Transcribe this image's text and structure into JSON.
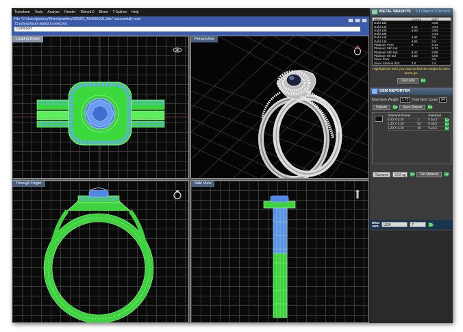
{
  "menubar": {
    "items": [
      "Transform",
      "Tools",
      "Analyze",
      "Render",
      "Rhino4.0",
      "Blend",
      "T-Splines",
      "Help"
    ]
  },
  "command": {
    "lines": [
      "File \"C:\\Users\\jpm\\ocs\\Rhino\\jewellery\\922822_RGW51201.3dm\" successfully read",
      "73 polysurfaces added to selection."
    ],
    "prompt": "Command:"
  },
  "viewports": {
    "top_left": {
      "title": "Looking Down"
    },
    "top_right": {
      "title": "Perspective"
    },
    "bottom_left": {
      "title": "Through Finger"
    },
    "bottom_right": {
      "title": "Side View"
    }
  },
  "metal_weights": {
    "header": "METAL WEIGHTS",
    "note": "13 Objects Checked",
    "columns": [
      "Metal",
      "Grams",
      "DWT"
    ],
    "rows": [
      [
        "Gold 18k",
        "",
        "4.63"
      ],
      [
        "Gold 14k",
        "5.44",
        "4.04"
      ],
      [
        "Gold 10k",
        "5.50",
        "3.50"
      ],
      [
        "Gold 18k",
        "",
        "4.34"
      ],
      [
        "Gold 14k",
        "4.95",
        "2.5"
      ],
      [
        "Gold 14k",
        "4.95",
        "2.9"
      ],
      [
        "Platinum Pure",
        "9",
        "5.14"
      ],
      [
        "Platinum 950 Ind",
        "",
        "5.74"
      ],
      [
        "Platinum 950 Ind",
        "9.02",
        "5.80"
      ],
      [
        "Platinum 85 Ind",
        "8.60",
        "5.80"
      ],
      [
        "Silver Pure",
        "",
        "2.6"
      ],
      [
        "Silver Sterling 925",
        "3.8",
        "2.4"
      ]
    ],
    "hint": "Highlight the item you want to find the weight for then press go.",
    "calculate_label": "Calculate"
  },
  "gem_reporter": {
    "header": "GEM REPORTER",
    "total_weight_label": "Total Gem Weight",
    "total_weight_value": "1.73",
    "total_count_label": "Total Gem Count",
    "total_count_value": "94",
    "update_label": "Update",
    "save_label": "Save Report",
    "columns": [
      "Diamond Round",
      "",
      "Diamond"
    ],
    "rows": [
      {
        "size": "5.20 X 5.20",
        "qty": "1",
        "ct": "0.51ct"
      },
      {
        "size": "1.30 X 1.30",
        "qty": "52",
        "ct": "0.48ct"
      },
      {
        "size": "1.20 X 1.20",
        "qty": "40",
        "ct": "0.23ct"
      }
    ],
    "gem_select": "Diamond",
    "gem_value": "3.52 sg",
    "set_material_label": "Set Material"
  },
  "ring_size": {
    "label_line1": "RING",
    "label_line2": "SIZE",
    "standard": "USA",
    "size": "7"
  },
  "go_label": "Go",
  "colors": {
    "wire_green": "#4dff4d",
    "wire_blue": "#5b9cff",
    "panel_bg": "#3b3b3b",
    "cmd_bg": "#3a5ba9"
  }
}
